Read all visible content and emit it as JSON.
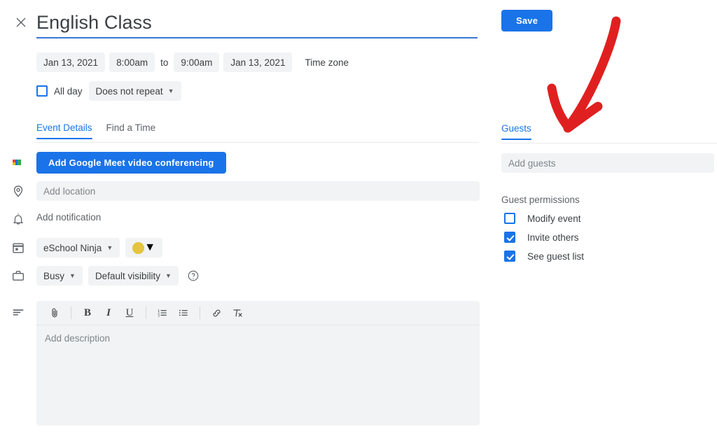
{
  "header": {
    "close_icon": "close-icon",
    "title": "English Class"
  },
  "datetime": {
    "start_date": "Jan 13, 2021",
    "start_time": "8:00am",
    "separator": "to",
    "end_time": "9:00am",
    "end_date": "Jan 13, 2021",
    "timezone_label": "Time zone"
  },
  "recurrence": {
    "all_day_label": "All day",
    "all_day_checked": false,
    "repeat_label": "Does not repeat"
  },
  "tabs": [
    {
      "label": "Event Details",
      "active": true
    },
    {
      "label": "Find a Time",
      "active": false
    }
  ],
  "rows": {
    "meet_button": "Add Google Meet video conferencing",
    "location_placeholder": "Add location",
    "notification_label": "Add notification",
    "calendar_name": "eSchool Ninja",
    "color_value": "#e4c441",
    "busy_label": "Busy",
    "visibility_label": "Default visibility"
  },
  "description": {
    "placeholder": "Add description",
    "toolbar": [
      "attachment-icon",
      "bold-icon",
      "italic-icon",
      "underline-icon",
      "numbered-list-icon",
      "bulleted-list-icon",
      "link-icon",
      "clear-formatting-icon"
    ]
  },
  "right": {
    "save_label": "Save",
    "guests_tab_label": "Guests",
    "guests_placeholder": "Add guests",
    "permissions_title": "Guest permissions",
    "permissions": [
      {
        "label": "Modify event",
        "checked": false
      },
      {
        "label": "Invite others",
        "checked": true
      },
      {
        "label": "See guest list",
        "checked": true
      }
    ]
  },
  "annotation": {
    "type": "arrow",
    "color": "#e02020",
    "points_to": "Guests"
  },
  "colors": {
    "accent_blue": "#1a73e8",
    "title_underline": "#3c78d8",
    "chip_bg": "#f1f3f4",
    "text_primary": "#3c4043",
    "text_secondary": "#5f6368",
    "placeholder": "#80868b"
  }
}
